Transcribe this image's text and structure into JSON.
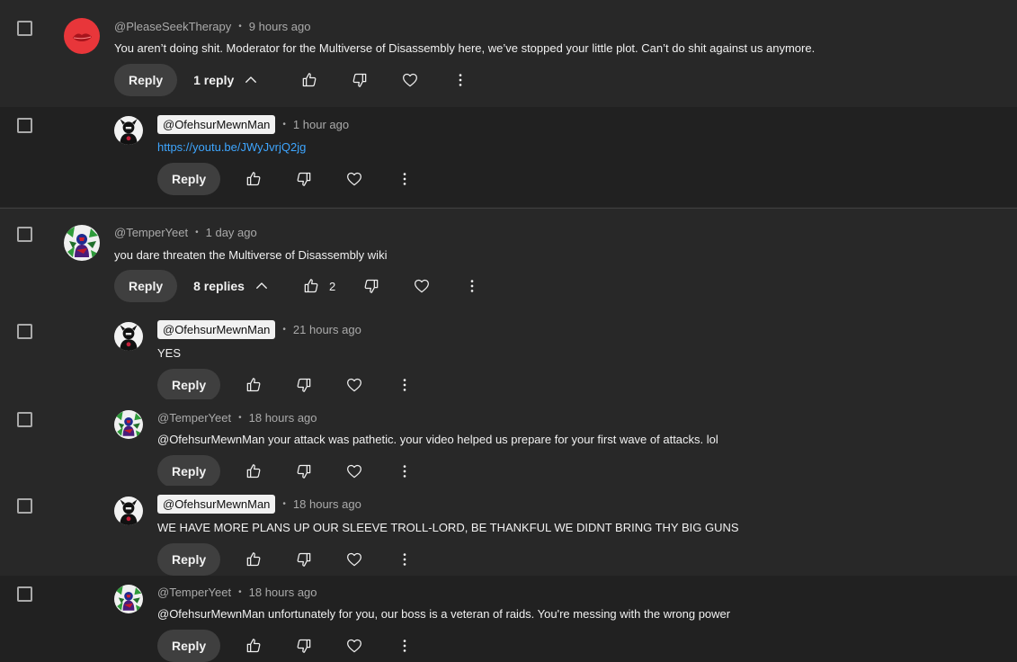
{
  "colors": {
    "background": "#282828",
    "reply_background": "#212121",
    "link": "#3ea6ff",
    "text": "#f1f1f1",
    "meta": "#aaaaaa"
  },
  "comments": [
    {
      "handle": "@PleaseSeekTherapy",
      "time": "9 hours ago",
      "text": "You aren’t doing shit. Moderator for the Multiverse of Disassembly here, we’ve stopped your little plot. Can’t do shit against us anymore.",
      "reply_label": "Reply",
      "replies_toggle": "1 reply",
      "avatar_icon": "red-lips-avatar"
    },
    {
      "handle": "@OfehsurMewnMan",
      "time": "1 hour ago",
      "link_text": "https://youtu.be/JWyJvrjQ2jg",
      "reply_label": "Reply",
      "avatar_icon": "knight-avatar"
    },
    {
      "handle": "@TemperYeet",
      "time": "1 day ago",
      "text": "you dare threaten the Multiverse of Disassembly wiki",
      "reply_label": "Reply",
      "replies_toggle": "8 replies",
      "like_count": "2",
      "avatar_icon": "colorful-figure-avatar"
    },
    {
      "handle": "@OfehsurMewnMan",
      "time": "21 hours ago",
      "text": "YES",
      "reply_label": "Reply",
      "avatar_icon": "knight-avatar"
    },
    {
      "handle": "@TemperYeet",
      "time": "18 hours ago",
      "text": "@OfehsurMewnMan your attack was pathetic. your video helped us prepare for your first wave of attacks. lol",
      "reply_label": "Reply",
      "avatar_icon": "colorful-figure-avatar"
    },
    {
      "handle": "@OfehsurMewnMan",
      "time": "18 hours ago",
      "text": "WE HAVE MORE PLANS UP OUR SLEEVE TROLL-LORD, BE THANKFUL WE DIDNT BRING THY BIG GUNS",
      "reply_label": "Reply",
      "avatar_icon": "knight-avatar"
    },
    {
      "handle": "@TemperYeet",
      "time": "18 hours ago",
      "text": "@OfehsurMewnMan unfortunately for you, our boss is a veteran of raids. You're messing with the wrong power",
      "reply_label": "Reply",
      "avatar_icon": "colorful-figure-avatar"
    }
  ],
  "separator": "•"
}
